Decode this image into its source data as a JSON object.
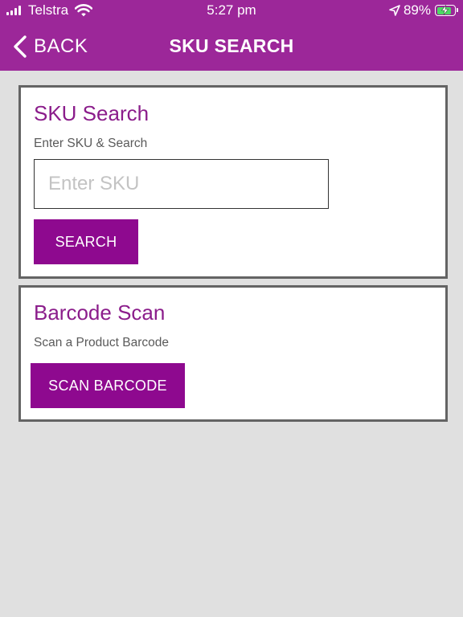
{
  "status_bar": {
    "carrier": "Telstra",
    "time": "5:27 pm",
    "battery_percent": "89%",
    "battery_level": 0.89,
    "icons": [
      "signal-icon",
      "wifi-icon",
      "location-arrow-icon",
      "battery-charging-icon"
    ]
  },
  "nav": {
    "back_label": "BACK",
    "title": "SKU SEARCH"
  },
  "sku_card": {
    "title": "SKU Search",
    "subtitle": "Enter SKU & Search",
    "input_placeholder": "Enter SKU",
    "input_value": "",
    "button_label": "SEARCH"
  },
  "barcode_card": {
    "title": "Barcode Scan",
    "subtitle": "Scan a Product Barcode",
    "button_label": "SCAN BARCODE"
  },
  "colors": {
    "header": "#9c2799",
    "accent_text": "#8b1d8b",
    "button": "#8e098f",
    "background": "#e0e0e0",
    "card_border": "#646464",
    "battery_charge": "#4cd964"
  }
}
